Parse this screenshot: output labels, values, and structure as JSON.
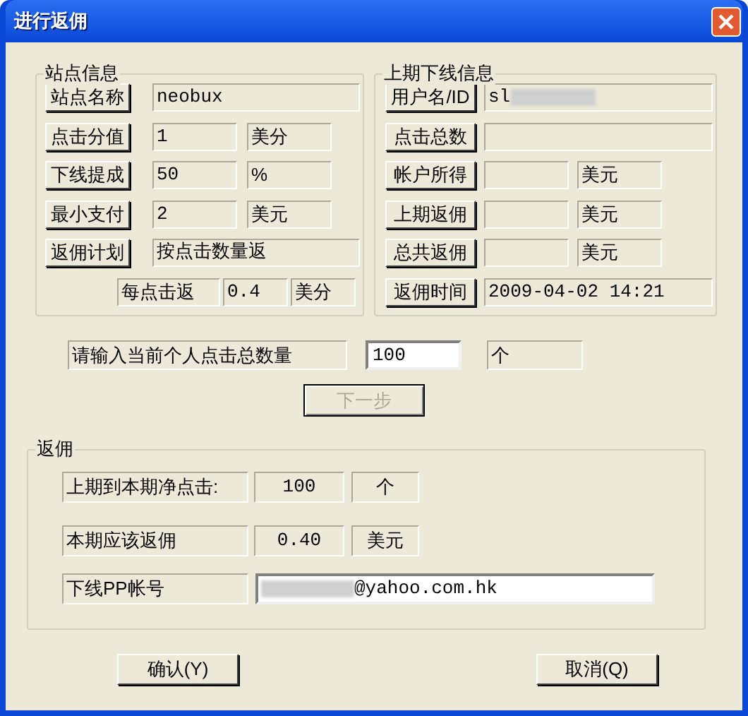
{
  "window": {
    "title": "进行返佣"
  },
  "site_info": {
    "title": "站点信息",
    "rows": [
      {
        "button": "站点名称",
        "value": "neobux"
      },
      {
        "button": "点击分值",
        "value": "1",
        "unit": "美分"
      },
      {
        "button": "下线提成",
        "value": "50",
        "unit": "%"
      },
      {
        "button": "最小支付",
        "value": "2",
        "unit": "美元"
      },
      {
        "button": "返佣计划",
        "value": "按点击数量返"
      }
    ],
    "per_click": {
      "label": "每点击返",
      "value": "0.4",
      "unit": "美分"
    }
  },
  "last_period": {
    "title": "上期下线信息",
    "rows": [
      {
        "button": "用户名/ID",
        "value": "sl",
        "redacted": true
      },
      {
        "button": "点击总数"
      },
      {
        "button": "帐户所得",
        "unit": "美元"
      },
      {
        "button": "上期返佣",
        "unit": "美元"
      },
      {
        "button": "总共返佣",
        "unit": "美元"
      },
      {
        "button": "返佣时间",
        "value": "2009-04-02 14:21"
      }
    ]
  },
  "click_input": {
    "label": "请输入当前个人点击总数量",
    "value": "100",
    "unit": "个"
  },
  "next_button": {
    "label": "下一步",
    "disabled": true
  },
  "rebate": {
    "title": "返佣",
    "rows": [
      {
        "label": "上期到本期净点击:",
        "value": "100",
        "unit": "个"
      },
      {
        "label": "本期应该返佣",
        "value": "0.40",
        "unit": "美元"
      }
    ],
    "paypal": {
      "label": "下线PP帐号",
      "value": "@yahoo.com.hk",
      "redacted": true
    }
  },
  "buttons": [
    "确认(Y)",
    "取消(Q)"
  ]
}
